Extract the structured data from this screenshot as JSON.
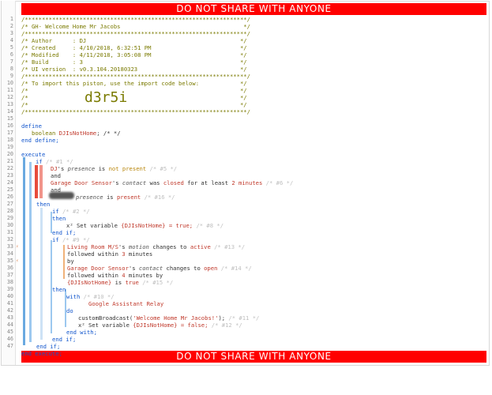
{
  "banner": {
    "top_text": "DO NOT SHARE WITH ANYONE",
    "bottom_text": "DO NOT SHARE WITH ANYONE"
  },
  "line_numbers": [
    "1",
    "2",
    "3",
    "4",
    "5",
    "6",
    "7",
    "8",
    "9",
    "10",
    "11",
    "12",
    "13",
    "14",
    "15",
    "16",
    "17",
    "18",
    "19",
    "20",
    "21",
    "22",
    "23",
    "24",
    "25",
    "26",
    "27",
    "28",
    "29",
    "30",
    "31",
    "32",
    "33",
    "34",
    "35",
    "36",
    "37",
    "38",
    "39",
    "40",
    "41",
    "42",
    "43",
    "44",
    "45",
    "46",
    "47"
  ],
  "header": {
    "stars": "/*****************************************************************/",
    "title_line": "/* GH- Welcome Home Mr Jacobs                                    */",
    "author_line": "/* Author      : DJ                                             */",
    "created_line": "/* Created     : 4/10/2018, 6:32:51 PM                          */",
    "modified_line": "/* Modified    : 4/11/2018, 3:05:08 PM                          */",
    "build_line": "/* Build       : 3                                              */",
    "ui_line": "/* UI version  : v0.3.104.20180323                              */",
    "import_line": "/* To import this piston, use the import code below:            */",
    "blank_line": "/*                                                              */",
    "import_code": "d3r5i"
  },
  "code": {
    "define": "define",
    "boolean": "boolean",
    "var_name": "DJIsNotHome",
    "define_comment": "/* */",
    "end_define": "end define;",
    "execute": "execute",
    "if_kw": "if",
    "if1_comment": "/* #1 */",
    "l23_dev": "DJ",
    "l23_s": "'s",
    "l23_attr": "presence",
    "l23_is": "is",
    "l23_op": "not present",
    "l23_cm": "/* #5 */",
    "and": "and",
    "l25_dev": "Garage Door Sensor",
    "l25_s": "'s",
    "l25_attr": "contact",
    "l25_op": "was",
    "l25_val": "closed",
    "l25_for": "for at least",
    "l25_num": "2",
    "l25_unit": "minutes",
    "l25_cm": "/* #6 */",
    "l27_attr": "presence",
    "l27_is": "is",
    "l27_val": "present",
    "l27_cm": "/* #16 */",
    "then": "then",
    "if2_comment": "/* #2 */",
    "x2": "x²",
    "set_variable": "Set variable",
    "true_assign": "{DJIsNotHome} = true;",
    "set1_cm": "/* #8 */",
    "end_if": "end if;",
    "if9_comment": "/* #9 */",
    "l33_dev": "Living Room M/S",
    "l33_s": "'s",
    "l33_attr": "motion",
    "l33_op": "changes to",
    "l33_val": "active",
    "l33_cm": "/* #13 */",
    "followed_within": "followed within",
    "l34_num": "3",
    "l34_unit": "minutes",
    "by": "by",
    "l35_dev": "Garage Door Sensor",
    "l35_s": "'s",
    "l35_attr": "contact",
    "l35_op": "changes to",
    "l35_val": "open",
    "l35_cm": "/* #14 */",
    "l36_num": "4",
    "l36_unit": "minutes",
    "l37_var": "{DJIsNotHome}",
    "l37_is": "is",
    "l37_val": "true",
    "l37_cm": "/* #15 */",
    "with_kw": "with",
    "with_cm": "/* #10 */",
    "device_relay": "Google Assistant Relay",
    "do_kw": "do",
    "custom_fn": "customBroadcast(",
    "custom_str": "'Welcome Home Mr Jacobs!'",
    "custom_end": ");",
    "custom_cm": "/* #11 */",
    "false_assign": "{DJIsNotHome} = false;",
    "set2_cm": "/* #12 */",
    "end_with": "end with;",
    "end_execute": "end execute;"
  },
  "colors": {
    "banner": "#ff0000",
    "comment": "#7a7a00",
    "keyword": "#1155cc",
    "device": "#c0392b",
    "operator": "#b8860b"
  },
  "icons": {
    "condition_marker": "lightning-icon",
    "action_marker": "square-icon"
  }
}
